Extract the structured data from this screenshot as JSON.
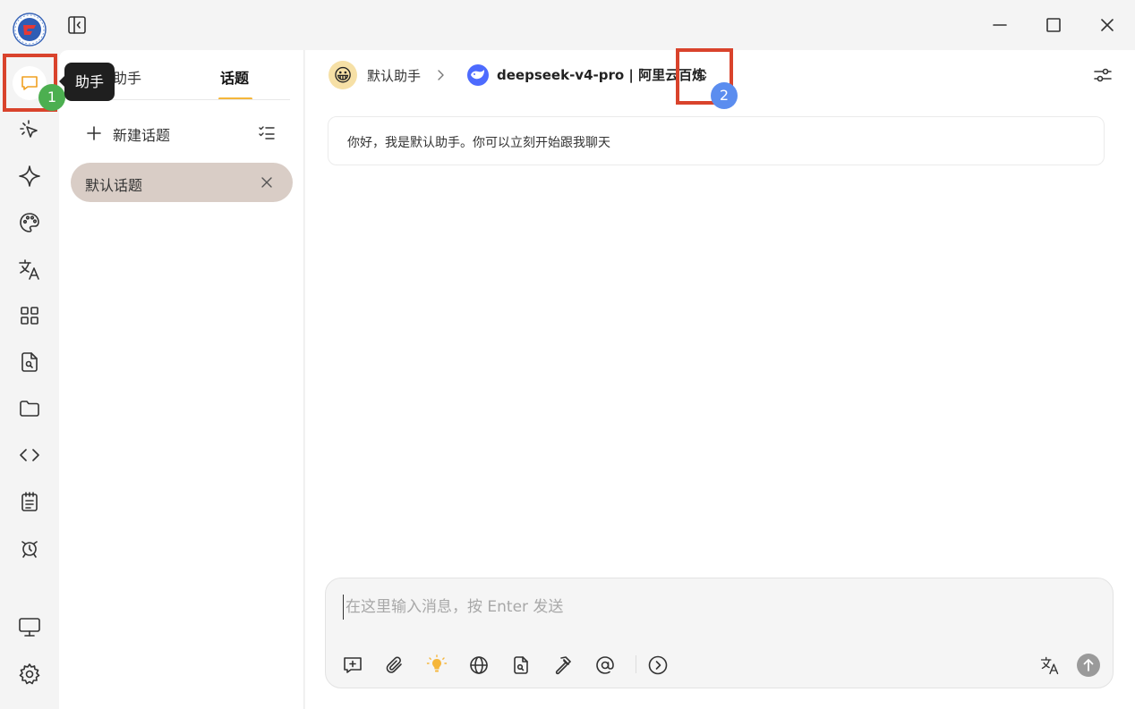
{
  "sidebar": {
    "tooltip": "助手",
    "items": [
      {
        "icon": "chat-bubble-icon"
      },
      {
        "icon": "agent-cursor-icon"
      },
      {
        "icon": "sparkle-icon"
      },
      {
        "icon": "palette-icon"
      },
      {
        "icon": "translate-icon"
      },
      {
        "icon": "apps-grid-icon"
      },
      {
        "icon": "file-search-icon"
      },
      {
        "icon": "folder-icon"
      },
      {
        "icon": "code-icon"
      },
      {
        "icon": "notes-icon"
      },
      {
        "icon": "alarm-clock-icon"
      }
    ],
    "bottom": [
      {
        "icon": "monitor-icon"
      },
      {
        "icon": "gear-icon"
      }
    ]
  },
  "annotations": [
    {
      "label": "1",
      "color": "#4caf50"
    },
    {
      "label": "2",
      "color": "#5b8def"
    }
  ],
  "topic_panel": {
    "tabs": [
      {
        "label": "助手",
        "active": false
      },
      {
        "label": "话题",
        "active": true
      }
    ],
    "new_topic_label": "新建话题",
    "topics": [
      {
        "label": "默认话题",
        "selected": true
      }
    ]
  },
  "main": {
    "assistant": {
      "avatar": "😀",
      "name": "默认助手"
    },
    "model": {
      "name": "deepseek-v4-pro | 阿里云百炼"
    },
    "welcome": "你好，我是默认助手。你可以立刻开始跟我聊天",
    "input": {
      "placeholder": "在这里输入消息，按 Enter 发送"
    }
  },
  "colors": {
    "accent": "#f5b63b",
    "selected_topic": "#d9cdc6",
    "annotation_box": "#d9432c",
    "model_icon": "#4d6bfe"
  }
}
